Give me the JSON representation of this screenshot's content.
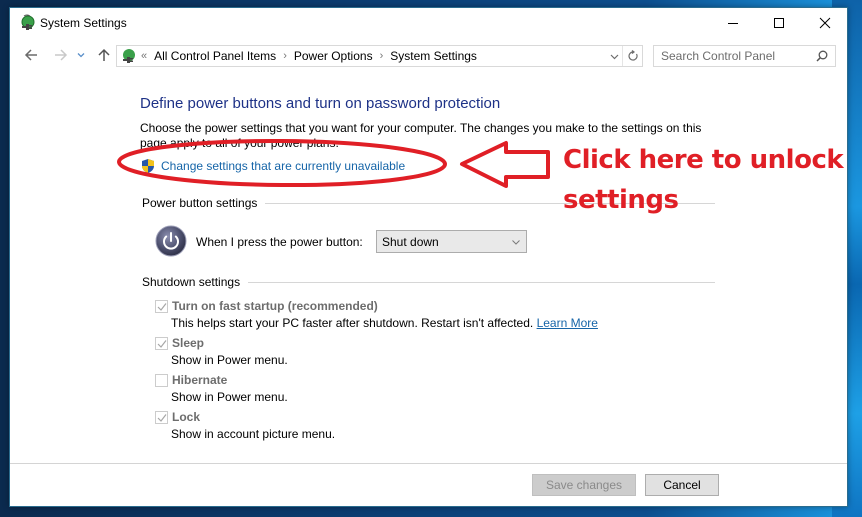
{
  "window": {
    "title": "System Settings",
    "controls": {
      "minimize": "minimize",
      "maximize": "maximize",
      "close": "close"
    }
  },
  "nav": {
    "back_icon": "arrow-left-icon",
    "forward_icon": "arrow-right-icon",
    "recent_icon": "chevron-down-icon",
    "up_icon": "arrow-up-icon",
    "breadcrumb_lead": "«",
    "breadcrumbs": [
      "All Control Panel Items",
      "Power Options",
      "System Settings"
    ],
    "breadcrumb_separator": "›",
    "search_placeholder": "Search Control Panel"
  },
  "content": {
    "heading": "Define power buttons and turn on password protection",
    "description": "Choose the power settings that you want for your computer. The changes you make to the settings on this page apply to all of your power plans.",
    "unlock_link": "Change settings that are currently unavailable",
    "power_group": {
      "label": "Power button settings",
      "power_button_label": "When I press the power button:",
      "power_button_value": "Shut down"
    },
    "shutdown_group": {
      "label": "Shutdown settings",
      "options": [
        {
          "title": "Turn on fast startup (recommended)",
          "desc": "This helps start your PC faster after shutdown. Restart isn't affected.",
          "link": "Learn More",
          "checked": true,
          "enabled": false
        },
        {
          "title": "Sleep",
          "desc": "Show in Power menu.",
          "checked": true,
          "enabled": false
        },
        {
          "title": "Hibernate",
          "desc": "Show in Power menu.",
          "checked": false,
          "enabled": false
        },
        {
          "title": "Lock",
          "desc": "Show in account picture menu.",
          "checked": true,
          "enabled": false
        }
      ]
    }
  },
  "footer": {
    "save_label": "Save changes",
    "save_enabled": false,
    "cancel_label": "Cancel"
  },
  "annotation": {
    "line1": "Click here to unlock",
    "line2": "settings",
    "color": "#e01f26"
  }
}
